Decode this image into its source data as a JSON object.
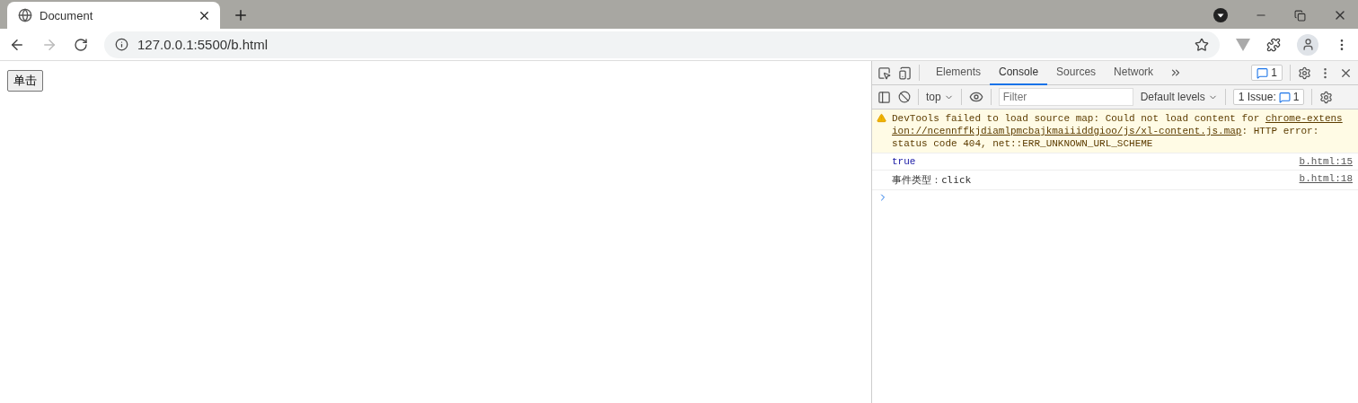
{
  "browser": {
    "tabs": [
      {
        "title": "Document",
        "selected": true
      }
    ],
    "address": "127.0.0.1:5500/b.html"
  },
  "page": {
    "button": "单击"
  },
  "devtools": {
    "tabs": [
      {
        "label": "Elements",
        "selected": false
      },
      {
        "label": "Console",
        "selected": true
      },
      {
        "label": "Sources",
        "selected": false
      },
      {
        "label": "Network",
        "selected": false
      }
    ],
    "messages_badge": "1",
    "context": "top",
    "filter": {
      "placeholder": "Filter"
    },
    "levels": "Default levels",
    "issues": {
      "label": "1 Issue:",
      "count": "1"
    },
    "messages": [
      {
        "kind": "warning",
        "lines": [
          [
            {
              "text": "DevTools failed to load source map: Could not load content for ",
              "link": false
            },
            {
              "text": "chrome-extens",
              "link": true
            }
          ],
          [
            {
              "text": "ion://ncennffkjdiamlpmcbajkmaiiiddgioo/js/xl-content.js.map",
              "link": true
            },
            {
              "text": ": HTTP error:",
              "link": false
            }
          ],
          [
            {
              "text": "status code 404, net::ERR_UNKNOWN_URL_SCHEME",
              "link": false
            }
          ]
        ]
      },
      {
        "kind": "boolean",
        "text": "true",
        "source": "b.html:15"
      },
      {
        "kind": "log",
        "text": "事件类型：click",
        "source": "b.html:18"
      }
    ]
  }
}
